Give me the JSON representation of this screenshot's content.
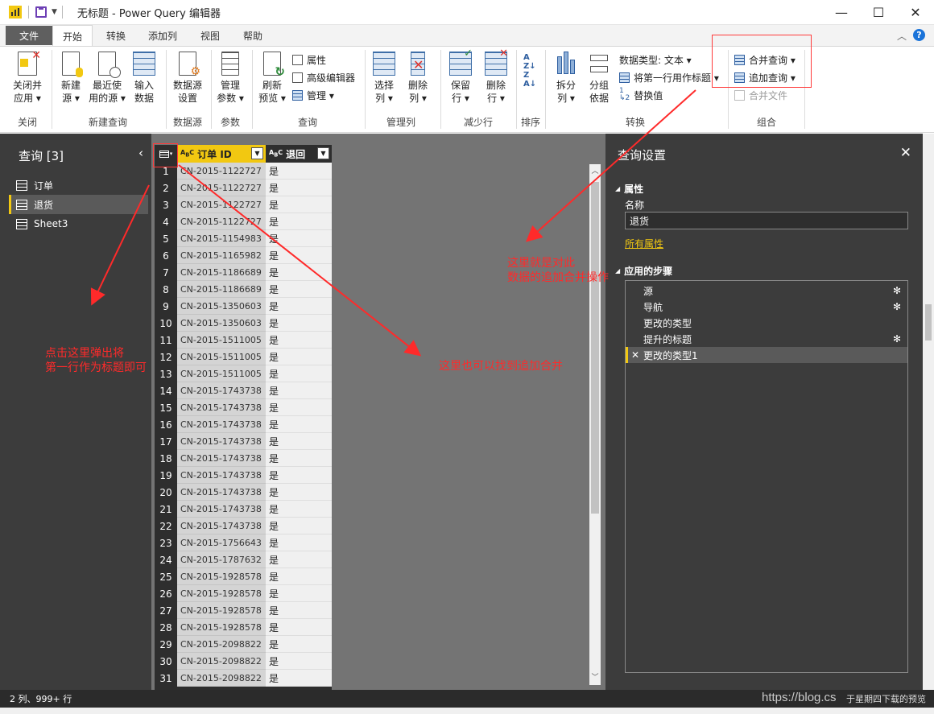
{
  "window": {
    "title": "无标题 - Power Query 编辑器",
    "minimize": "—",
    "maximize": "☐",
    "close": "✕"
  },
  "tabs": [
    {
      "label": "文件"
    },
    {
      "label": "开始"
    },
    {
      "label": "转换"
    },
    {
      "label": "添加列"
    },
    {
      "label": "视图"
    },
    {
      "label": "帮助"
    }
  ],
  "ribbon": {
    "close_apply": {
      "line1": "关闭并",
      "line2": "应用 ▾"
    },
    "new_source": {
      "line1": "新建",
      "line2": "源 ▾"
    },
    "recent_source": {
      "line1": "最近使",
      "line2": "用的源 ▾"
    },
    "enter_data": {
      "line1": "输入",
      "line2": "数据"
    },
    "datasource_settings": {
      "line1": "数据源",
      "line2": "设置"
    },
    "manage_params": {
      "line1": "管理",
      "line2": "参数 ▾"
    },
    "refresh_preview": {
      "line1": "刷新",
      "line2": "预览 ▾"
    },
    "properties": "属性",
    "advanced_editor": "高级编辑器",
    "manage": "管理 ▾",
    "choose_columns": {
      "line1": "选择",
      "line2": "列 ▾"
    },
    "remove_columns": {
      "line1": "删除",
      "line2": "列 ▾"
    },
    "keep_rows": {
      "line1": "保留",
      "line2": "行 ▾"
    },
    "remove_rows": {
      "line1": "删除",
      "line2": "行 ▾"
    },
    "split_column": {
      "line1": "拆分",
      "line2": "列 ▾"
    },
    "group_by": {
      "line1": "分组",
      "line2": "依据"
    },
    "data_type": "数据类型: 文本 ▾",
    "first_row_header": "将第一行用作标题 ▾",
    "replace_values": "替换值",
    "merge_queries": "合并查询 ▾",
    "append_queries": "追加查询 ▾",
    "combine_files": "合并文件",
    "groups": {
      "close": "关闭",
      "new_query": "新建查询",
      "data_source": "数据源",
      "params": "参数",
      "query": "查询",
      "manage_columns": "管理列",
      "reduce_rows": "减少行",
      "sort": "排序",
      "transform": "转换",
      "combine": "组合"
    }
  },
  "queries": {
    "title": "查询 [3]",
    "items": [
      {
        "label": "订单"
      },
      {
        "label": "退货"
      },
      {
        "label": "Sheet3"
      }
    ]
  },
  "table": {
    "columns": [
      "订单 ID",
      "退回"
    ],
    "rows": [
      {
        "n": "1",
        "id": "CN-2015-1122727",
        "ret": "是"
      },
      {
        "n": "2",
        "id": "CN-2015-1122727",
        "ret": "是"
      },
      {
        "n": "3",
        "id": "CN-2015-1122727",
        "ret": "是"
      },
      {
        "n": "4",
        "id": "CN-2015-1122727",
        "ret": "是"
      },
      {
        "n": "5",
        "id": "CN-2015-1154983",
        "ret": "是"
      },
      {
        "n": "6",
        "id": "CN-2015-1165982",
        "ret": "是"
      },
      {
        "n": "7",
        "id": "CN-2015-1186689",
        "ret": "是"
      },
      {
        "n": "8",
        "id": "CN-2015-1186689",
        "ret": "是"
      },
      {
        "n": "9",
        "id": "CN-2015-1350603",
        "ret": "是"
      },
      {
        "n": "10",
        "id": "CN-2015-1350603",
        "ret": "是"
      },
      {
        "n": "11",
        "id": "CN-2015-1511005",
        "ret": "是"
      },
      {
        "n": "12",
        "id": "CN-2015-1511005",
        "ret": "是"
      },
      {
        "n": "13",
        "id": "CN-2015-1511005",
        "ret": "是"
      },
      {
        "n": "14",
        "id": "CN-2015-1743738",
        "ret": "是"
      },
      {
        "n": "15",
        "id": "CN-2015-1743738",
        "ret": "是"
      },
      {
        "n": "16",
        "id": "CN-2015-1743738",
        "ret": "是"
      },
      {
        "n": "17",
        "id": "CN-2015-1743738",
        "ret": "是"
      },
      {
        "n": "18",
        "id": "CN-2015-1743738",
        "ret": "是"
      },
      {
        "n": "19",
        "id": "CN-2015-1743738",
        "ret": "是"
      },
      {
        "n": "20",
        "id": "CN-2015-1743738",
        "ret": "是"
      },
      {
        "n": "21",
        "id": "CN-2015-1743738",
        "ret": "是"
      },
      {
        "n": "22",
        "id": "CN-2015-1743738",
        "ret": "是"
      },
      {
        "n": "23",
        "id": "CN-2015-1756643",
        "ret": "是"
      },
      {
        "n": "24",
        "id": "CN-2015-1787632",
        "ret": "是"
      },
      {
        "n": "25",
        "id": "CN-2015-1928578",
        "ret": "是"
      },
      {
        "n": "26",
        "id": "CN-2015-1928578",
        "ret": "是"
      },
      {
        "n": "27",
        "id": "CN-2015-1928578",
        "ret": "是"
      },
      {
        "n": "28",
        "id": "CN-2015-1928578",
        "ret": "是"
      },
      {
        "n": "29",
        "id": "CN-2015-2098822",
        "ret": "是"
      },
      {
        "n": "30",
        "id": "CN-2015-2098822",
        "ret": "是"
      },
      {
        "n": "31",
        "id": "CN-2015-2098822",
        "ret": "是"
      }
    ]
  },
  "settings": {
    "title": "查询设置",
    "properties_label": "属性",
    "name_label": "名称",
    "name_value": "退货",
    "all_properties": "所有属性",
    "applied_steps_label": "应用的步骤",
    "steps": [
      {
        "label": "源",
        "gear": "✻"
      },
      {
        "label": "导航",
        "gear": "✻"
      },
      {
        "label": "更改的类型",
        "gear": ""
      },
      {
        "label": "提升的标题",
        "gear": "✻"
      },
      {
        "label": "更改的类型1",
        "gear": ""
      }
    ]
  },
  "status": {
    "left": "2 列、999+ 行",
    "right": "于星期四下载的预览",
    "watermark": "https://blog.cs"
  },
  "annotations": {
    "left_line1": "点击这里弹出将",
    "left_line2": "第一行作为标题即可",
    "middle": "这里也可以找到追加合并",
    "right_line1": "这里就是对此",
    "right_line2": "数据的追加合并操作"
  }
}
